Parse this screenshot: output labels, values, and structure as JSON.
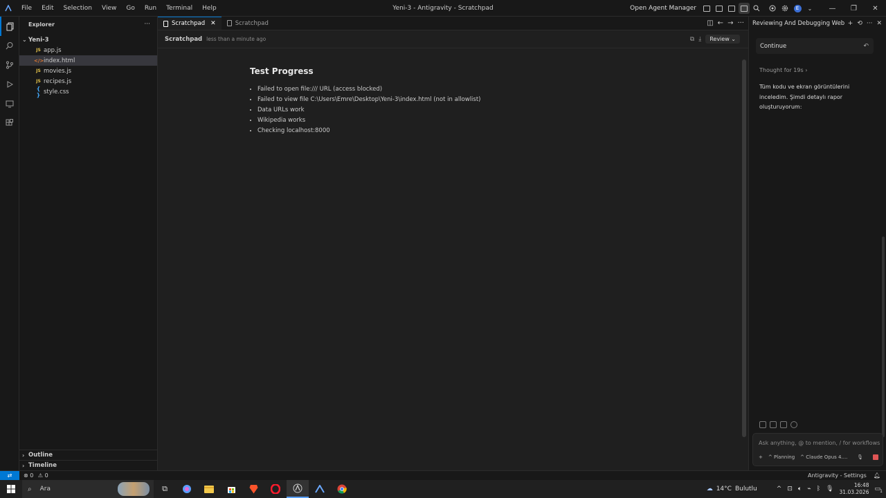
{
  "titlebar": {
    "menu": [
      "File",
      "Edit",
      "Selection",
      "View",
      "Go",
      "Run",
      "Terminal",
      "Help"
    ],
    "window_title": "Yeni-3 - Antigravity - Scratchpad",
    "agent_manager": "Open Agent Manager",
    "avatar_letter": "E"
  },
  "sidebar": {
    "title": "Explorer",
    "more": "···",
    "folder": "Yeni-3",
    "files": [
      {
        "icon": "JS",
        "name": "app.js"
      },
      {
        "icon": "</>",
        "name": "index.html"
      },
      {
        "icon": "JS",
        "name": "movies.js"
      },
      {
        "icon": "JS",
        "name": "recipes.js"
      },
      {
        "icon": "{ }",
        "name": "style.css"
      }
    ],
    "sections": [
      "Outline",
      "Timeline"
    ]
  },
  "editor": {
    "tabs": [
      {
        "label": "Scratchpad",
        "active": true
      },
      {
        "label": "Scratchpad",
        "active": false
      }
    ],
    "doc_name": "Scratchpad",
    "doc_time": "less than a minute ago",
    "review_label": "Review",
    "heading": "Test Progress",
    "items": [
      "Failed to open file:/// URL (access blocked)",
      "Failed to view file C:\\Users\\Emre\\Desktop\\Yeni-3\\index.html (not in allowlist)",
      "Data URLs work",
      "Wikipedia works",
      "Checking localhost:8000"
    ]
  },
  "agent_panel": {
    "title": "Reviewing And Debugging Web",
    "continue_label": "Continue",
    "thought": "Thought for 19s",
    "message": "Tüm kodu ve ekran görüntülerini inceledim. Şimdi detaylı rapor oluşturuyorum:",
    "input_placeholder": "Ask anything, @ to mention, / for workflows",
    "mode": "Planning",
    "model": "Claude Opus 4...."
  },
  "statusbar": {
    "errors": "0",
    "warnings": "0",
    "settings": "Antigravity - Settings"
  },
  "taskbar": {
    "search_label": "Ara",
    "weather_temp": "14°C",
    "weather_desc": "Bulutlu",
    "time": "16:48",
    "date": "31.03.2026",
    "notif_count": "1"
  },
  "colors": {
    "accent": "#0078d4",
    "bg_editor": "#1f1f1f",
    "bg_chrome": "#181818"
  }
}
